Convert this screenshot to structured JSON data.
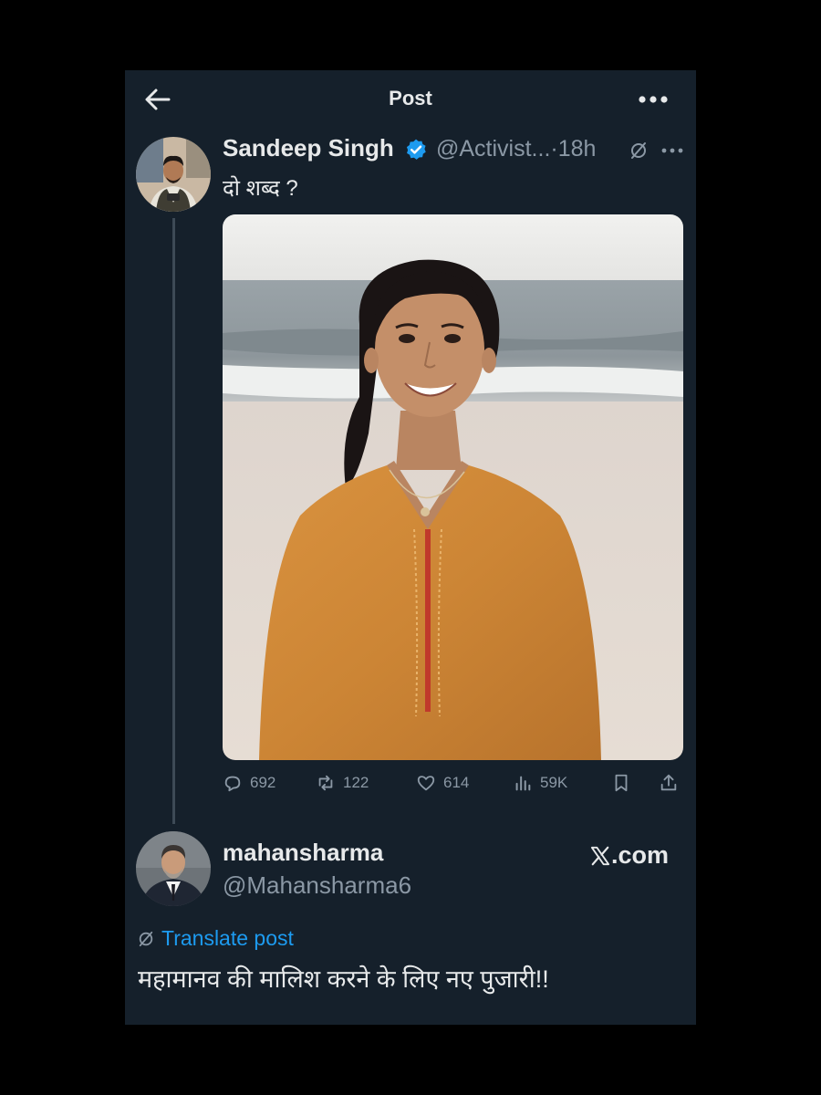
{
  "header": {
    "title": "Post"
  },
  "post": {
    "author_name": "Sandeep Singh",
    "author_handle": "@Activist...",
    "time": "·18h",
    "text": "दो शब्द ?",
    "stats": {
      "replies": "692",
      "reposts": "122",
      "likes": "614",
      "views": "59K"
    }
  },
  "quote": {
    "author_name": "mahansharma",
    "author_handle": "@Mahansharma6",
    "source": ".com",
    "translate_label": "Translate post",
    "text": "महामानव की मालिश करने के लिए नए पुजारी!!"
  },
  "colors": {
    "background": "#15202b",
    "accent": "#1d9bf0",
    "muted": "#8b98a5",
    "text": "#e7e9ea"
  }
}
